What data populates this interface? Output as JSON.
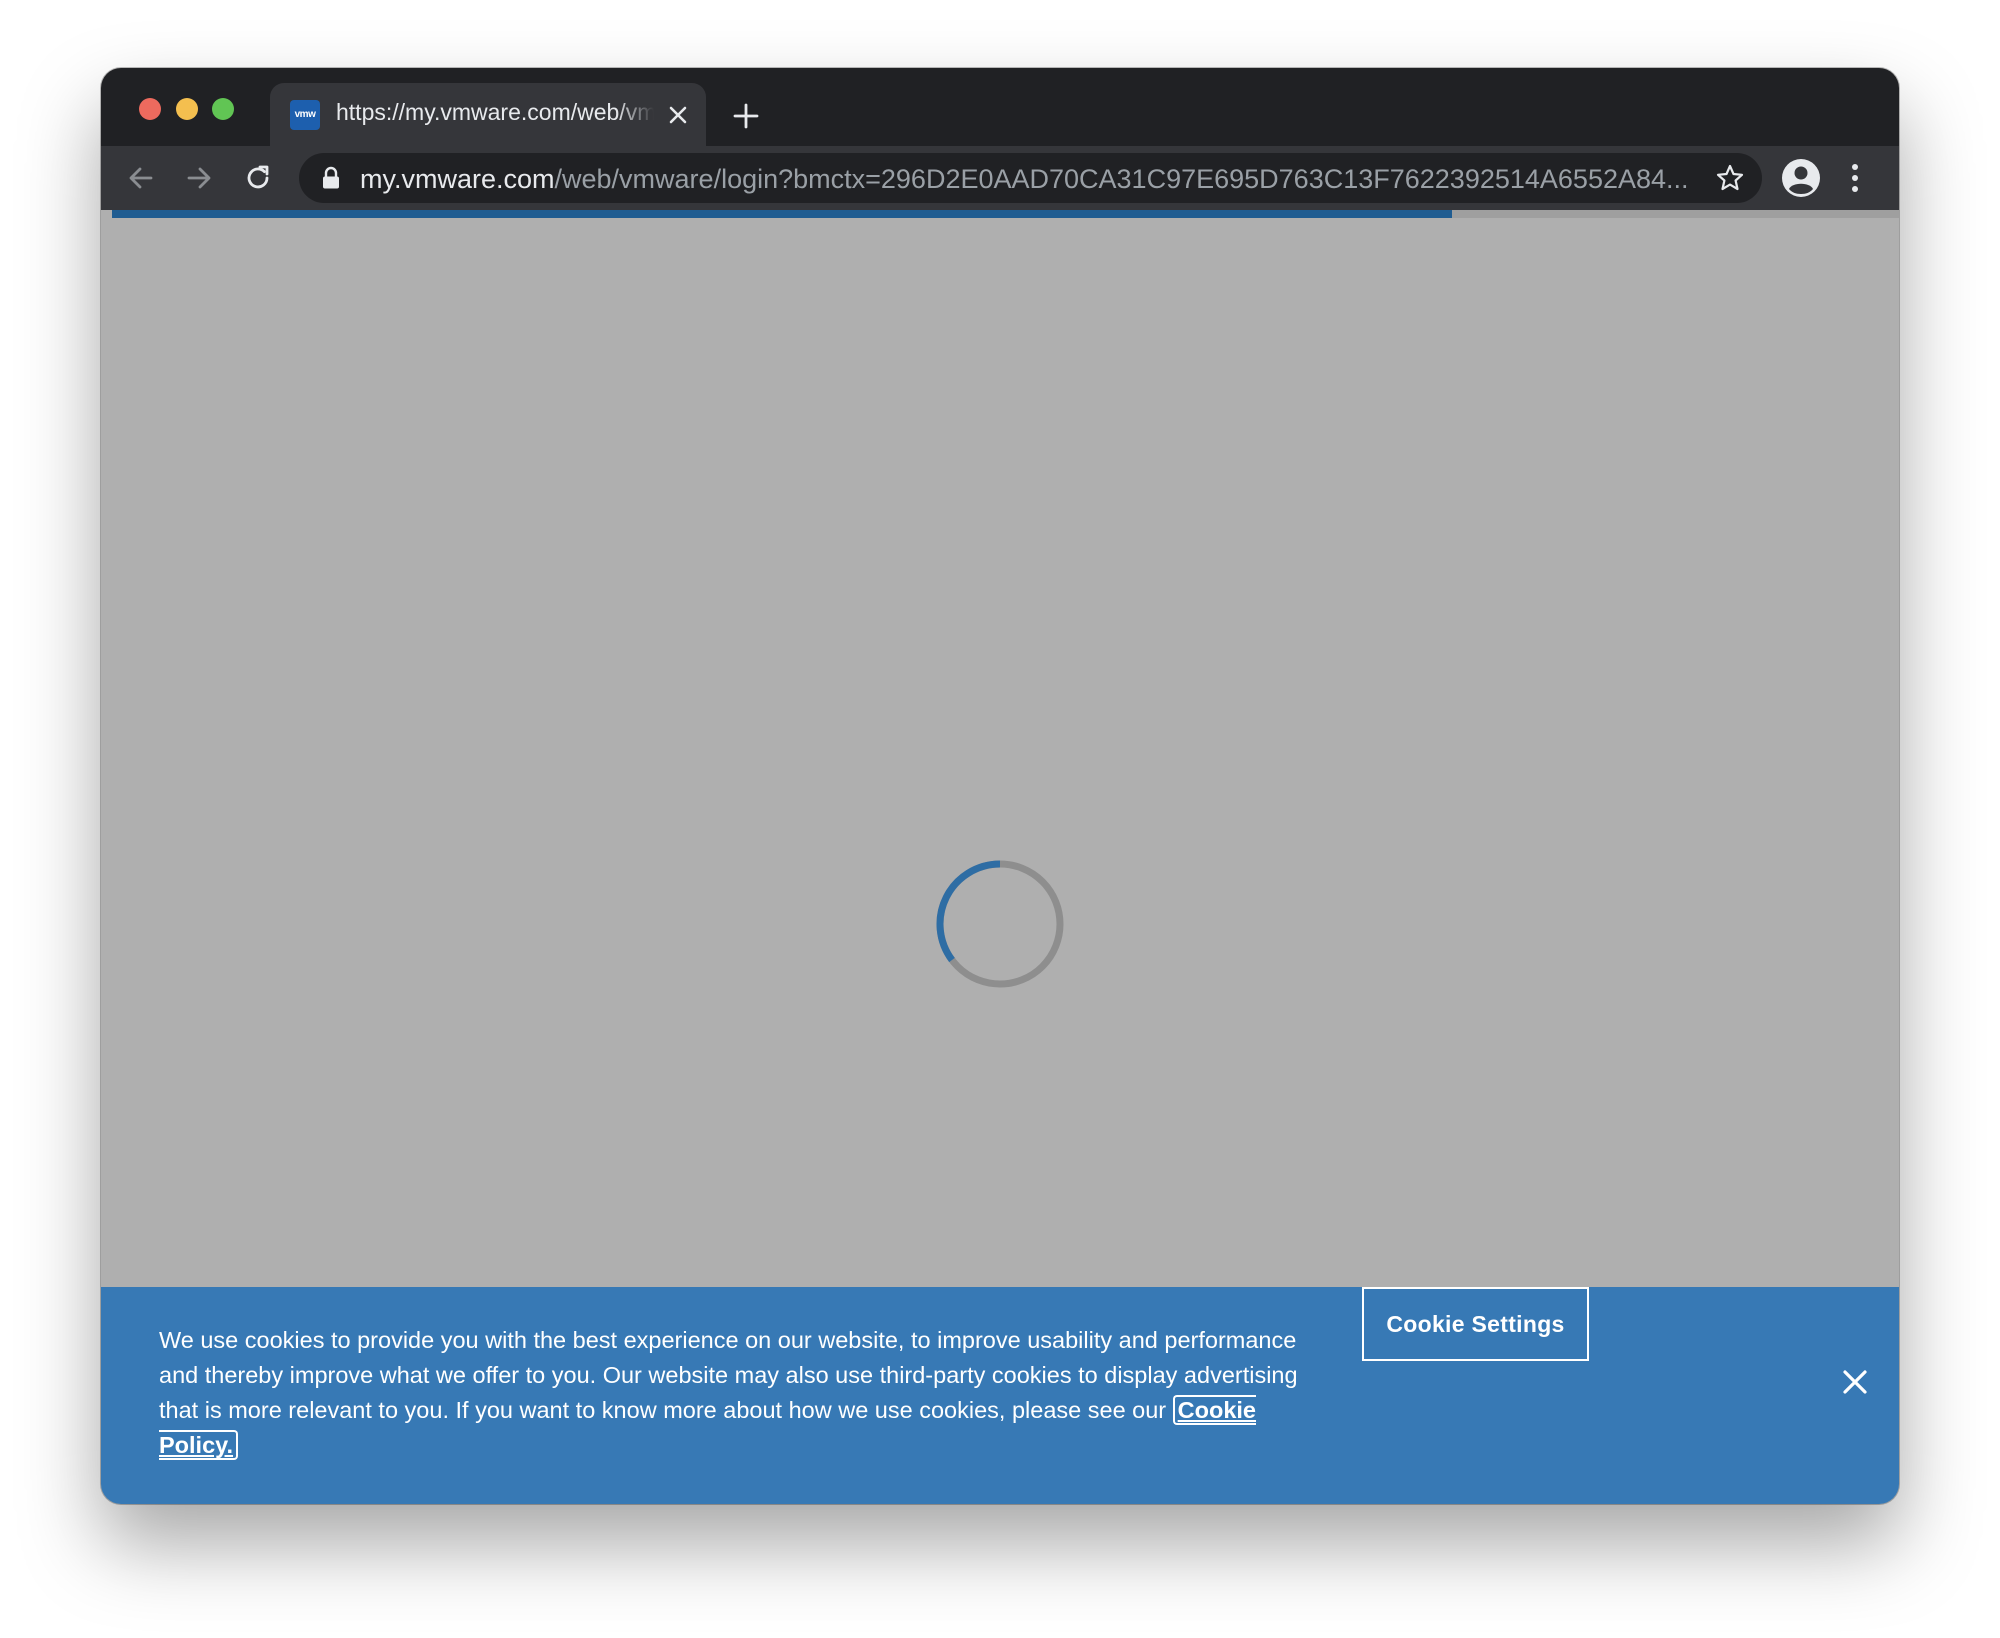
{
  "browser": {
    "tab": {
      "favicon_text": "vmw",
      "title": "https://my.vmware.com/web/vmware/login"
    },
    "address_bar": {
      "url_host": "my.vmware.com",
      "url_path": "/web/vmware/login?bmctx=296D2E0AAD70CA31C97E695D763C13F7622392514A6552A84..."
    },
    "loading_progress": 0.75,
    "icons": {
      "back": "arrow-left-icon",
      "forward": "arrow-right-icon",
      "reload": "reload-icon",
      "lock": "lock-icon",
      "bookmark": "star-icon",
      "profile": "account-circle-icon",
      "menu": "kebab-menu-icon",
      "tab_close": "close-icon",
      "new_tab": "plus-icon"
    }
  },
  "page": {
    "state": "loading",
    "spinner_color": "#2e6da4"
  },
  "cookie_banner": {
    "text": "We use cookies to provide you with the best experience on our website, to improve usability and performance and thereby improve what we offer to you. Our website may also use third-party cookies to display advertising that is more relevant to you. If you want to know more about how we use cookies, please see our ",
    "policy_link": "Cookie Policy.",
    "settings_button": "Cookie Settings",
    "background_color": "#3779b5"
  }
}
